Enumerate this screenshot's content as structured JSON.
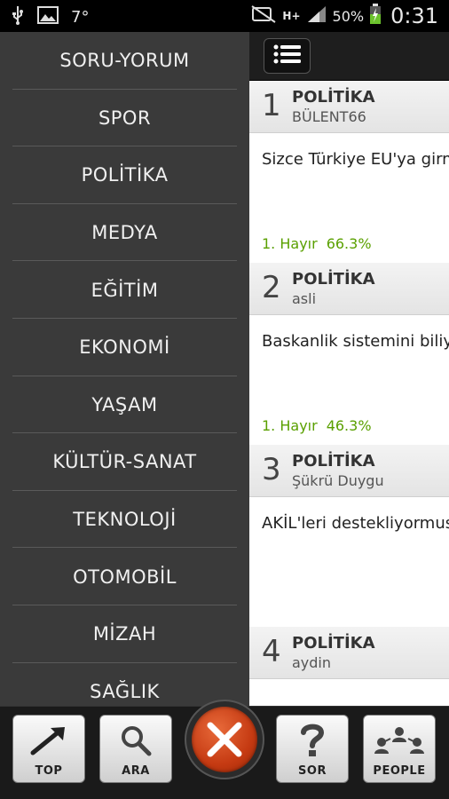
{
  "status_bar": {
    "temperature": "7°",
    "battery_percent": "50%",
    "network": "H+",
    "time": "0:31"
  },
  "drawer": {
    "items": [
      {
        "label": "SORU-YORUM"
      },
      {
        "label": "SPOR"
      },
      {
        "label": "POLİTİKA"
      },
      {
        "label": "MEDYA"
      },
      {
        "label": "EĞİTİM"
      },
      {
        "label": "EKONOMİ"
      },
      {
        "label": "YAŞAM"
      },
      {
        "label": "KÜLTÜR-SANAT"
      },
      {
        "label": "TEKNOLOJİ"
      },
      {
        "label": "OTOMOBİL"
      },
      {
        "label": "MİZAH"
      },
      {
        "label": "SAĞLIK"
      }
    ]
  },
  "questions": [
    {
      "rank": "1",
      "category": "POLİTİKA",
      "user": "BÜLENT66",
      "text": "Sizce Türkiye EU'ya girm",
      "result_label": "1. Hayır",
      "result_pct": "66.3%"
    },
    {
      "rank": "2",
      "category": "POLİTİKA",
      "user": "asli",
      "text": "Baskanlik sistemini biliy",
      "result_label": "1. Hayır",
      "result_pct": "46.3%"
    },
    {
      "rank": "3",
      "category": "POLİTİKA",
      "user": "Şükrü Duygu",
      "text": "AKİL'leri destekliyormus",
      "result_label": "",
      "result_pct": ""
    },
    {
      "rank": "4",
      "category": "POLİTİKA",
      "user": "aydin",
      "text": "",
      "result_label": "",
      "result_pct": ""
    }
  ],
  "bottom_bar": {
    "top_label": "TOP",
    "ara_label": "ARA",
    "sor_label": "SOR",
    "people_label": "PEOPLE"
  },
  "colors": {
    "drawer_bg": "#3a3a3a",
    "result_green": "#5aa000",
    "close_red": "#c53a12"
  }
}
